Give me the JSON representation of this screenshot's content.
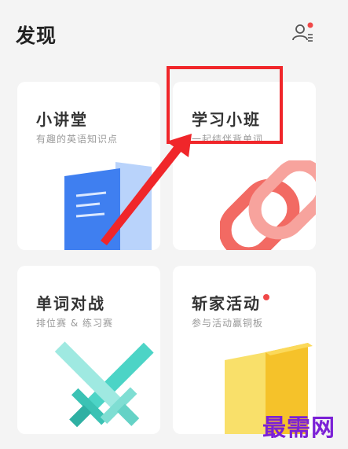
{
  "header": {
    "title": "发现"
  },
  "cards": [
    {
      "title": "小讲堂",
      "subtitle": "有趣的英语知识点"
    },
    {
      "title": "学习小班",
      "subtitle": "一起结伴背单词"
    },
    {
      "title": "单词对战",
      "subtitle": "排位赛 & 练习赛"
    },
    {
      "title": "斩家活动",
      "subtitle": "参与活动赢铜板"
    }
  ],
  "icons": {
    "user": "user-settings-icon",
    "lecture": "book-illustration",
    "group": "chain-link-illustration",
    "battle": "crossed-swords-illustration",
    "events": "gold-blocks-illustration"
  },
  "colors": {
    "accent_red": "#f0262a",
    "book_blue": "#3f7ff0",
    "link_red": "#f26a63",
    "sword_teal": "#4cd4c6",
    "gold": "#f5c22a"
  },
  "watermark": "最需网"
}
